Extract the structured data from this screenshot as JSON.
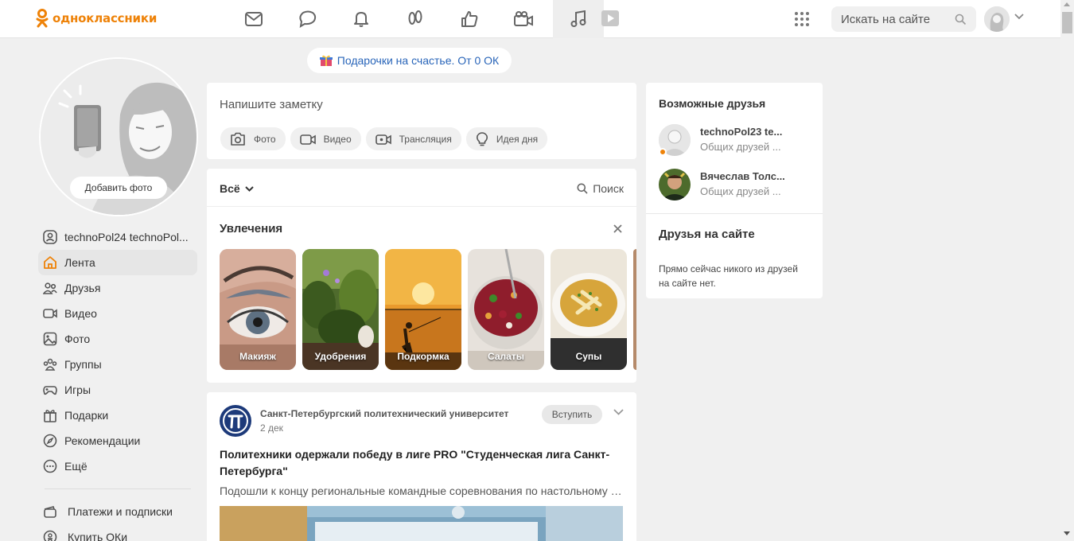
{
  "header": {
    "logo_text": "одноклассники",
    "brand_color": "#ee8208",
    "nav_icons": [
      "messages-icon",
      "discussions-icon",
      "notifications-icon",
      "guests-icon",
      "marks-icon",
      "video-icon",
      "music-icon"
    ],
    "search_placeholder": "Искать на сайте"
  },
  "promo": {
    "gift_text": "Подарочки на счастье. От 0 ОК"
  },
  "profile": {
    "add_photo_label": "Добавить фото"
  },
  "sidebar": {
    "items": [
      {
        "label": "technoPol24 technoPol...",
        "icon": "user-icon"
      },
      {
        "label": "Лента",
        "icon": "home-icon"
      },
      {
        "label": "Друзья",
        "icon": "friends-icon"
      },
      {
        "label": "Видео",
        "icon": "video-icon"
      },
      {
        "label": "Фото",
        "icon": "photo-icon"
      },
      {
        "label": "Группы",
        "icon": "groups-icon"
      },
      {
        "label": "Игры",
        "icon": "gamepad-icon"
      },
      {
        "label": "Подарки",
        "icon": "gift-icon"
      },
      {
        "label": "Рекомендации",
        "icon": "compass-icon"
      },
      {
        "label": "Ещё",
        "icon": "more-icon"
      }
    ],
    "extra": [
      {
        "label": "Платежи и подписки",
        "icon": "wallet-icon"
      },
      {
        "label": "Купить ОКи",
        "icon": "ok-coin-icon"
      }
    ]
  },
  "note": {
    "placeholder": "Напишите заметку",
    "buttons": [
      "Фото",
      "Видео",
      "Трансляция",
      "Идея дня"
    ]
  },
  "feed": {
    "filter_label": "Всё",
    "search_label": "Поиск",
    "hobbies_title": "Увлечения",
    "hobbies": [
      "Макияж",
      "Удобрения",
      "Подкормка",
      "Салаты",
      "Супы"
    ]
  },
  "post": {
    "author": "Санкт-Петербургский политехнический университет",
    "date": "2 дек",
    "join_label": "Вступить",
    "title": "Политехники одержали победу в лиге PRO \"Студенческая лига Санкт-Петербурга\"",
    "text": "Подошли к концу региональные командные соревнования по настольному теннису"
  },
  "right": {
    "possible_friends_title": "Возможные друзья",
    "friends": [
      {
        "name": "technoPol23 te...",
        "mutual": "Общих друзей ...",
        "online": true
      },
      {
        "name": "Вячеслав Толс...",
        "mutual": "Общих друзей ...",
        "online": false
      }
    ],
    "online_title": "Друзья на сайте",
    "online_empty": "Прямо сейчас никого из друзей на сайте нет."
  }
}
